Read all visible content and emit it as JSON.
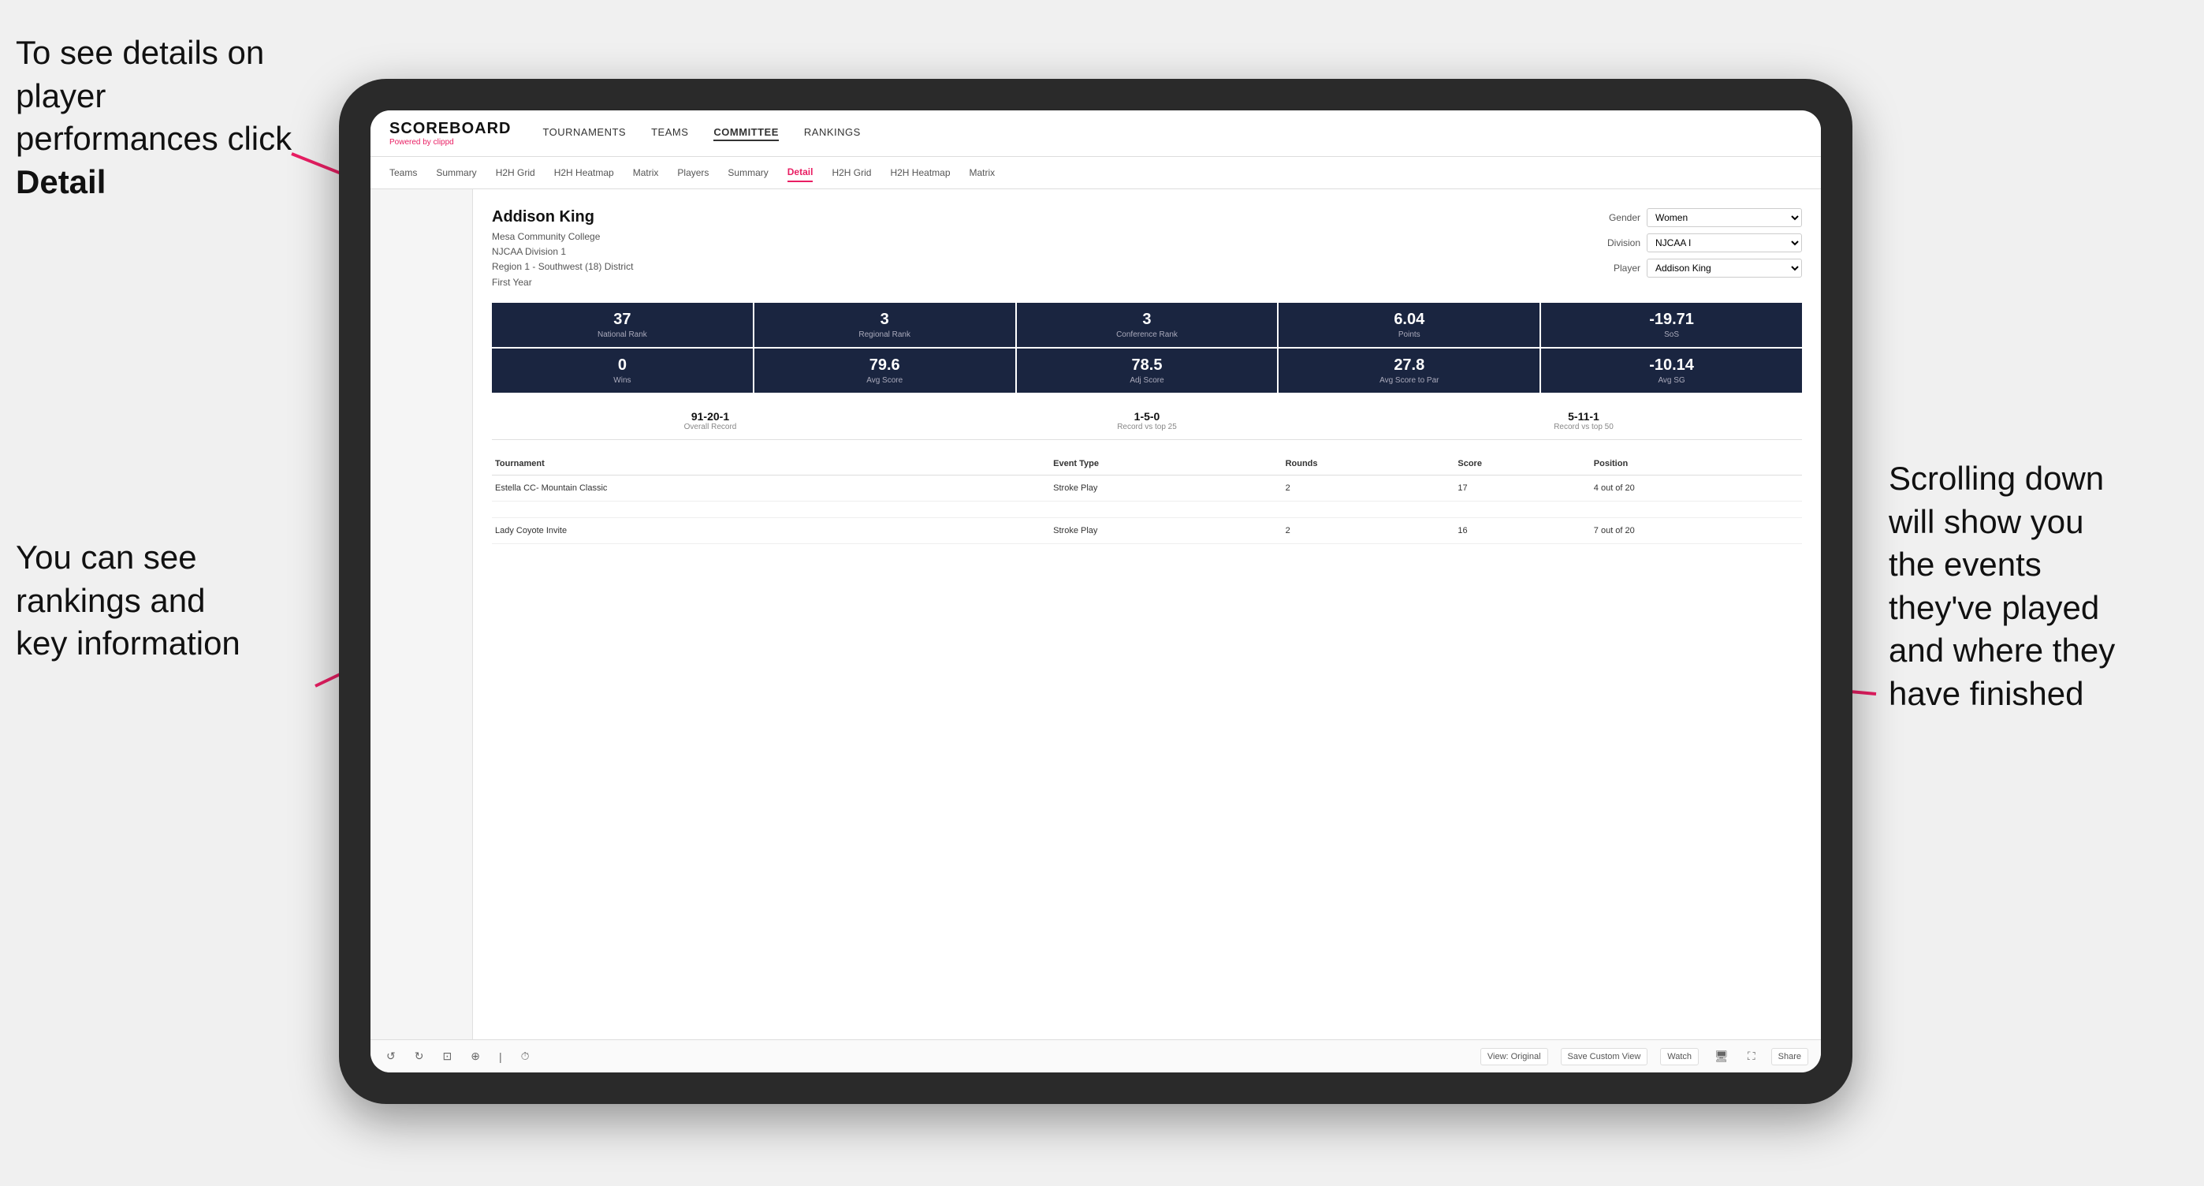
{
  "annotations": {
    "top_left": "To see details on player performances click ",
    "top_left_bold": "Detail",
    "bottom_left_line1": "You can see",
    "bottom_left_line2": "rankings and",
    "bottom_left_line3": "key information",
    "right_line1": "Scrolling down",
    "right_line2": "will show you",
    "right_line3": "the events",
    "right_line4": "they've played",
    "right_line5": "and where they",
    "right_line6": "have finished"
  },
  "nav": {
    "logo": "SCOREBOARD",
    "powered_by": "Powered by ",
    "powered_brand": "clippd",
    "links": [
      "TOURNAMENTS",
      "TEAMS",
      "COMMITTEE",
      "RANKINGS"
    ]
  },
  "sub_nav": {
    "links": [
      "Teams",
      "Summary",
      "H2H Grid",
      "H2H Heatmap",
      "Matrix",
      "Players",
      "Summary",
      "Detail",
      "H2H Grid",
      "H2H Heatmap",
      "Matrix"
    ]
  },
  "player": {
    "name": "Addison King",
    "college": "Mesa Community College",
    "division": "NJCAA Division 1",
    "region": "Region 1 - Southwest (18) District",
    "year": "First Year"
  },
  "filters": {
    "gender_label": "Gender",
    "gender_value": "Women",
    "division_label": "Division",
    "division_value": "NJCAA I",
    "player_label": "Player",
    "player_value": "Addison King"
  },
  "stats_row1": [
    {
      "value": "37",
      "label": "National Rank"
    },
    {
      "value": "3",
      "label": "Regional Rank"
    },
    {
      "value": "3",
      "label": "Conference Rank"
    },
    {
      "value": "6.04",
      "label": "Points"
    },
    {
      "value": "-19.71",
      "label": "SoS"
    }
  ],
  "stats_row2": [
    {
      "value": "0",
      "label": "Wins"
    },
    {
      "value": "79.6",
      "label": "Avg Score"
    },
    {
      "value": "78.5",
      "label": "Adj Score"
    },
    {
      "value": "27.8",
      "label": "Avg Score to Par"
    },
    {
      "value": "-10.14",
      "label": "Avg SG"
    }
  ],
  "records": [
    {
      "value": "91-20-1",
      "label": "Overall Record"
    },
    {
      "value": "1-5-0",
      "label": "Record vs top 25"
    },
    {
      "value": "5-11-1",
      "label": "Record vs top 50"
    }
  ],
  "table": {
    "headers": [
      "Tournament",
      "",
      "Event Type",
      "Rounds",
      "Score",
      "Position"
    ],
    "rows": [
      {
        "tournament": "Estella CC- Mountain Classic",
        "event_type": "Stroke Play",
        "rounds": "2",
        "score": "17",
        "position": "4 out of 20"
      },
      {
        "tournament": "",
        "event_type": "",
        "rounds": "",
        "score": "",
        "position": ""
      },
      {
        "tournament": "Lady Coyote Invite",
        "event_type": "Stroke Play",
        "rounds": "2",
        "score": "16",
        "position": "7 out of 20"
      }
    ]
  },
  "toolbar": {
    "view_original": "View: Original",
    "save_custom": "Save Custom View",
    "watch": "Watch",
    "share": "Share"
  }
}
